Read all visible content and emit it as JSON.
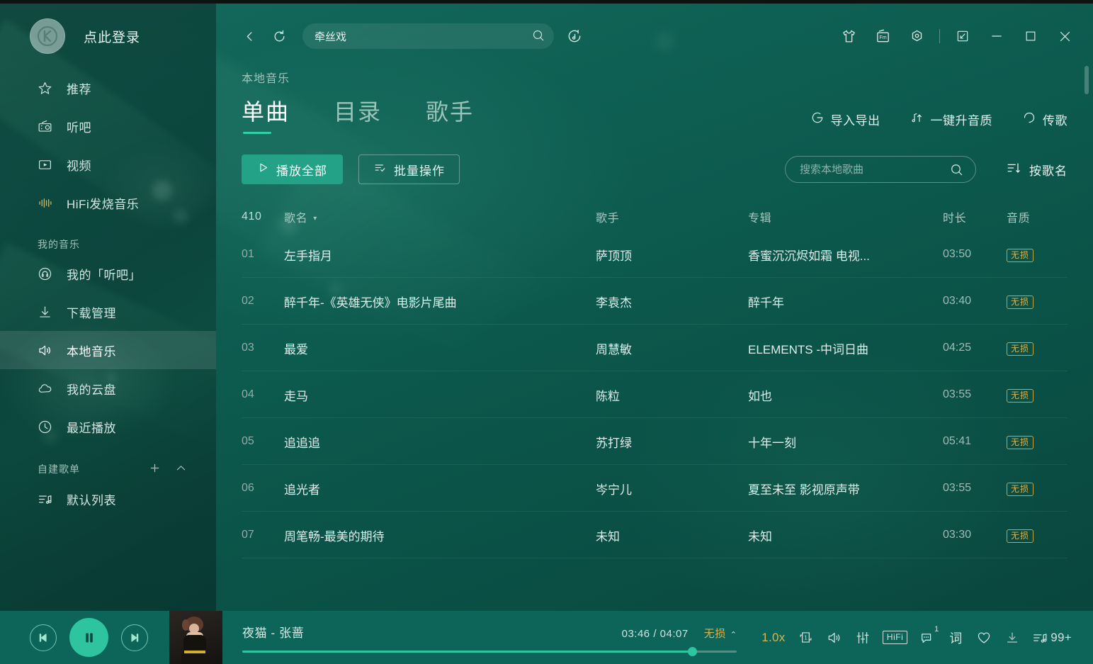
{
  "sidebar": {
    "login_label": "点此登录",
    "avatar_icon": "kugou-logo-icon",
    "nav": [
      {
        "label": "推荐",
        "icon": "star-icon"
      },
      {
        "label": "听吧",
        "icon": "radio-icon"
      },
      {
        "label": "视频",
        "icon": "video-icon"
      },
      {
        "label": "HiFi发烧音乐",
        "icon": "waveform-icon"
      }
    ],
    "group_mymusic": "我的音乐",
    "mymusic": [
      {
        "label": "我的「听吧」",
        "icon": "headphone-circle-icon"
      },
      {
        "label": "下载管理",
        "icon": "download-icon"
      },
      {
        "label": "本地音乐",
        "icon": "speaker-icon",
        "active": true
      },
      {
        "label": "我的云盘",
        "icon": "cloud-icon"
      },
      {
        "label": "最近播放",
        "icon": "clock-icon"
      }
    ],
    "group_playlists": "自建歌单",
    "group_add_icon": "plus-icon",
    "group_collapse_icon": "chevron-up-icon",
    "playlists": [
      {
        "label": "默认列表",
        "icon": "playlist-music-icon"
      }
    ]
  },
  "topbar": {
    "back_icon": "chevron-left-icon",
    "refresh_icon": "refresh-icon",
    "search": {
      "value": "牵丝戏",
      "placeholder": "",
      "icon": "search-icon"
    },
    "discover_icon": "music-discover-icon",
    "right_icons": [
      {
        "name": "skin-tshirt-icon",
        "glyph": "tshirt"
      },
      {
        "name": "fm-radio-icon",
        "glyph": "fm"
      },
      {
        "name": "settings-gear-icon",
        "glyph": "gear"
      }
    ],
    "window_icons": [
      {
        "name": "mini-mode-icon",
        "glyph": "mini"
      },
      {
        "name": "minimize-icon",
        "glyph": "min"
      },
      {
        "name": "maximize-icon",
        "glyph": "max"
      },
      {
        "name": "close-icon",
        "glyph": "close"
      }
    ]
  },
  "page": {
    "breadcrumb": "本地音乐",
    "tabs": [
      {
        "label": "单曲",
        "active": true
      },
      {
        "label": "目录",
        "active": false
      },
      {
        "label": "歌手",
        "active": false
      }
    ],
    "head_actions": [
      {
        "label": "导入导出",
        "icon": "import-export-icon"
      },
      {
        "label": "一键升音质",
        "icon": "upgrade-quality-icon"
      },
      {
        "label": "传歌",
        "icon": "transfer-song-icon"
      }
    ]
  },
  "toolbar": {
    "play_all_label": "播放全部",
    "play_all_icon": "play-triangle-icon",
    "batch_label": "批量操作",
    "batch_icon": "batch-list-icon",
    "search_placeholder": "搜索本地歌曲",
    "search_value": "",
    "search_icon": "search-icon",
    "sort_label": "按歌名",
    "sort_icon": "sort-icon"
  },
  "table": {
    "count": "410",
    "columns": {
      "name": "歌名",
      "artist": "歌手",
      "album": "专辑",
      "duration": "时长",
      "quality": "音质"
    },
    "sort_caret": "▾",
    "rows": [
      {
        "idx": "01",
        "name": "左手指月",
        "artist": "萨顶顶",
        "album": "香蜜沉沉烬如霜 电视...",
        "duration": "03:50",
        "quality": "无损"
      },
      {
        "idx": "02",
        "name": "醉千年-《英雄无侠》电影片尾曲",
        "artist": "李袁杰",
        "album": "醉千年",
        "duration": "03:40",
        "quality": "无损"
      },
      {
        "idx": "03",
        "name": "最爱",
        "artist": "周慧敏",
        "album": "ELEMENTS -中词日曲",
        "duration": "04:25",
        "quality": "无损"
      },
      {
        "idx": "04",
        "name": "走马",
        "artist": "陈粒",
        "album": "如也",
        "duration": "03:55",
        "quality": "无损"
      },
      {
        "idx": "05",
        "name": "追追追",
        "artist": "苏打绿",
        "album": "十年一刻",
        "duration": "05:41",
        "quality": "无损"
      },
      {
        "idx": "06",
        "name": "追光者",
        "artist": "岑宁儿",
        "album": "夏至未至 影视原声带",
        "duration": "03:55",
        "quality": "无损"
      },
      {
        "idx": "07",
        "name": "周笔畅-最美的期待",
        "artist": "未知",
        "album": "未知",
        "duration": "03:30",
        "quality": "无损"
      }
    ]
  },
  "player": {
    "prev_icon": "previous-track-icon",
    "play_icon": "pause-icon",
    "next_icon": "next-track-icon",
    "cover_icon": "album-art",
    "track_title": "夜猫 - 张蔷",
    "time": "03:46 / 04:07",
    "quality": "无损",
    "quality_caret": "⌃",
    "progress_percent": 91,
    "right": [
      {
        "name": "playback-speed-button",
        "label": "1.0x",
        "glyph": "text"
      },
      {
        "name": "repeat-one-icon",
        "label": "",
        "glyph": "repeat1"
      },
      {
        "name": "volume-icon",
        "label": "",
        "glyph": "volume"
      },
      {
        "name": "equalizer-icon",
        "label": "",
        "glyph": "eq"
      },
      {
        "name": "hifi-icon",
        "label": "HiFi",
        "glyph": "hifi"
      },
      {
        "name": "comment-icon",
        "label": "",
        "glyph": "comment",
        "badge": "1"
      },
      {
        "name": "lyrics-icon",
        "label": "词",
        "glyph": "text"
      },
      {
        "name": "favorite-heart-icon",
        "label": "",
        "glyph": "heart"
      },
      {
        "name": "download-icon",
        "label": "",
        "glyph": "download"
      },
      {
        "name": "playlist-queue-icon",
        "label": "",
        "glyph": "queue",
        "count": "99+"
      }
    ]
  }
}
